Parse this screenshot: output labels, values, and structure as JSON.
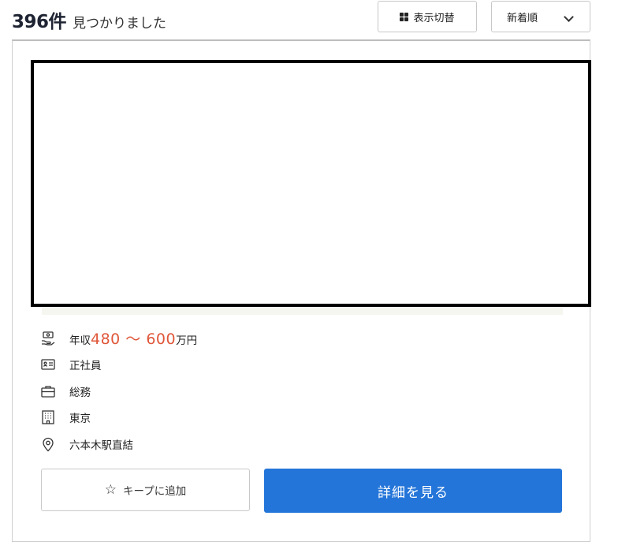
{
  "results": {
    "count": "396件",
    "found_text": "見つかりました"
  },
  "toolbar": {
    "toggle_label": "表示切替",
    "sort_selected": "新着順"
  },
  "job": {
    "salary_prefix": "年収",
    "salary_range": "480 〜 600",
    "salary_suffix": "万円",
    "employment_type": "正社員",
    "job_category": "総務",
    "location": "東京",
    "access": "六本木駅直結"
  },
  "actions": {
    "keep_label": "キープに追加",
    "detail_label": "詳細を見る"
  },
  "icons": {
    "salary": "money-hand-icon",
    "employment": "id-card-icon",
    "category": "briefcase-icon",
    "location": "building-icon",
    "access": "map-pin-icon",
    "keep": "star-icon",
    "toggle": "grid-icon",
    "sort": "chevron-down-icon"
  },
  "colors": {
    "salary_accent": "#e0573a",
    "primary_button": "#2475d9"
  }
}
